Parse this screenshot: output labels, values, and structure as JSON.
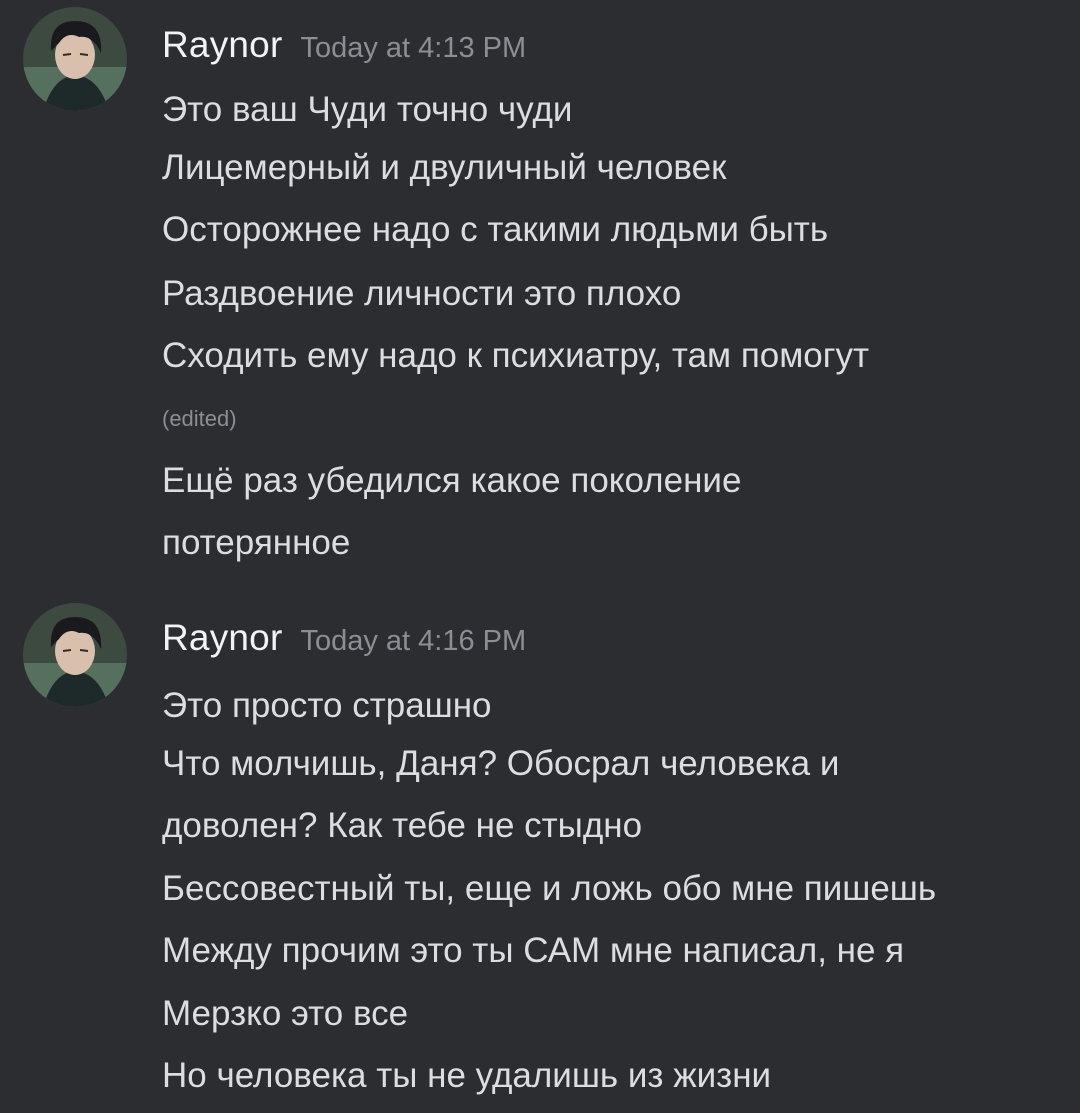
{
  "colors": {
    "background": "#2b2d31",
    "author": "#f2f3f5",
    "message_text": "#dcdde1",
    "muted": "#8b8e94"
  },
  "messages": [
    {
      "author": "Raynor",
      "timestamp": "Today at 4:13 PM",
      "avatar": "avatar-image",
      "lines": [
        "Это ваш Чуди точно чуди",
        "Лицемерный и двуличный человек",
        "Осторожнее надо с такими людьми быть",
        "Раздвоение личности это плохо",
        "Сходить ему надо к психиатру, там помогут"
      ],
      "edited_label": "(edited)",
      "after_lines": [
        "Ещё раз убедился какое поколение",
        "потерянное"
      ]
    },
    {
      "author": "Raynor",
      "timestamp": "Today at 4:16 PM",
      "avatar": "avatar-image",
      "lines": [
        "Это просто страшно",
        "Что молчишь, Даня? Обосрал человека и",
        "доволен? Как тебе не стыдно",
        "Бессовестный ты, еще и ложь обо мне пишешь",
        "Между прочим это ты САМ мне написал, не я",
        "Мерзко это все",
        "Но человека ты не удалишь из жизни"
      ]
    }
  ]
}
